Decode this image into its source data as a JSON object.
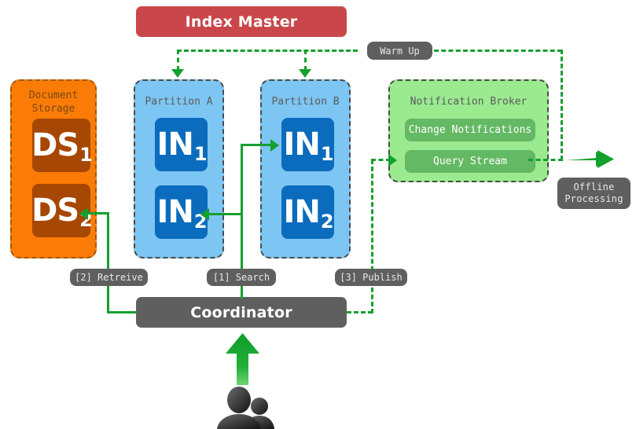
{
  "diagram": {
    "title": "Index Master",
    "nodes": {
      "index_master": {
        "label": "Index Master",
        "color": "#c9474a"
      },
      "document_storage": {
        "title_line1": "Document",
        "title_line2": "Storage",
        "color": "#fa7b05",
        "items": [
          {
            "label": "DS",
            "sub": "1",
            "color": "#a64704"
          },
          {
            "label": "DS",
            "sub": "2",
            "color": "#a64704"
          }
        ]
      },
      "partition_a": {
        "title": "Partition A",
        "color": "#7dc5f2",
        "items": [
          {
            "label": "IN",
            "sub": "1",
            "color": "#0b6cbd"
          },
          {
            "label": "IN",
            "sub": "2",
            "color": "#0b6cbd"
          }
        ]
      },
      "partition_b": {
        "title": "Partition B",
        "color": "#7dc5f2",
        "items": [
          {
            "label": "IN",
            "sub": "1",
            "color": "#0b6cbd"
          },
          {
            "label": "IN",
            "sub": "2",
            "color": "#0b6cbd"
          }
        ]
      },
      "notification_broker": {
        "title": "Notification Broker",
        "color": "#9bea90",
        "items": [
          {
            "label": "Change Notifications",
            "color": "#64b964"
          },
          {
            "label": "Query Stream",
            "color": "#64b964"
          }
        ]
      },
      "coordinator": {
        "label": "Coordinator",
        "color": "#5f5f5f"
      },
      "offline_processing": {
        "line1": "Offline",
        "line2": "Processing",
        "color": "#5f5f5f"
      },
      "users": {
        "label": "users"
      }
    },
    "edge_labels": {
      "warm_up": "Warm Up",
      "retrieve": "[2] Retreive",
      "search": "[1] Search",
      "publish": "[3] Publish"
    },
    "colors": {
      "edge_green": "#14a02e",
      "group_border": "#4a4a4a",
      "group_title_text": "#5c5c5c"
    }
  }
}
